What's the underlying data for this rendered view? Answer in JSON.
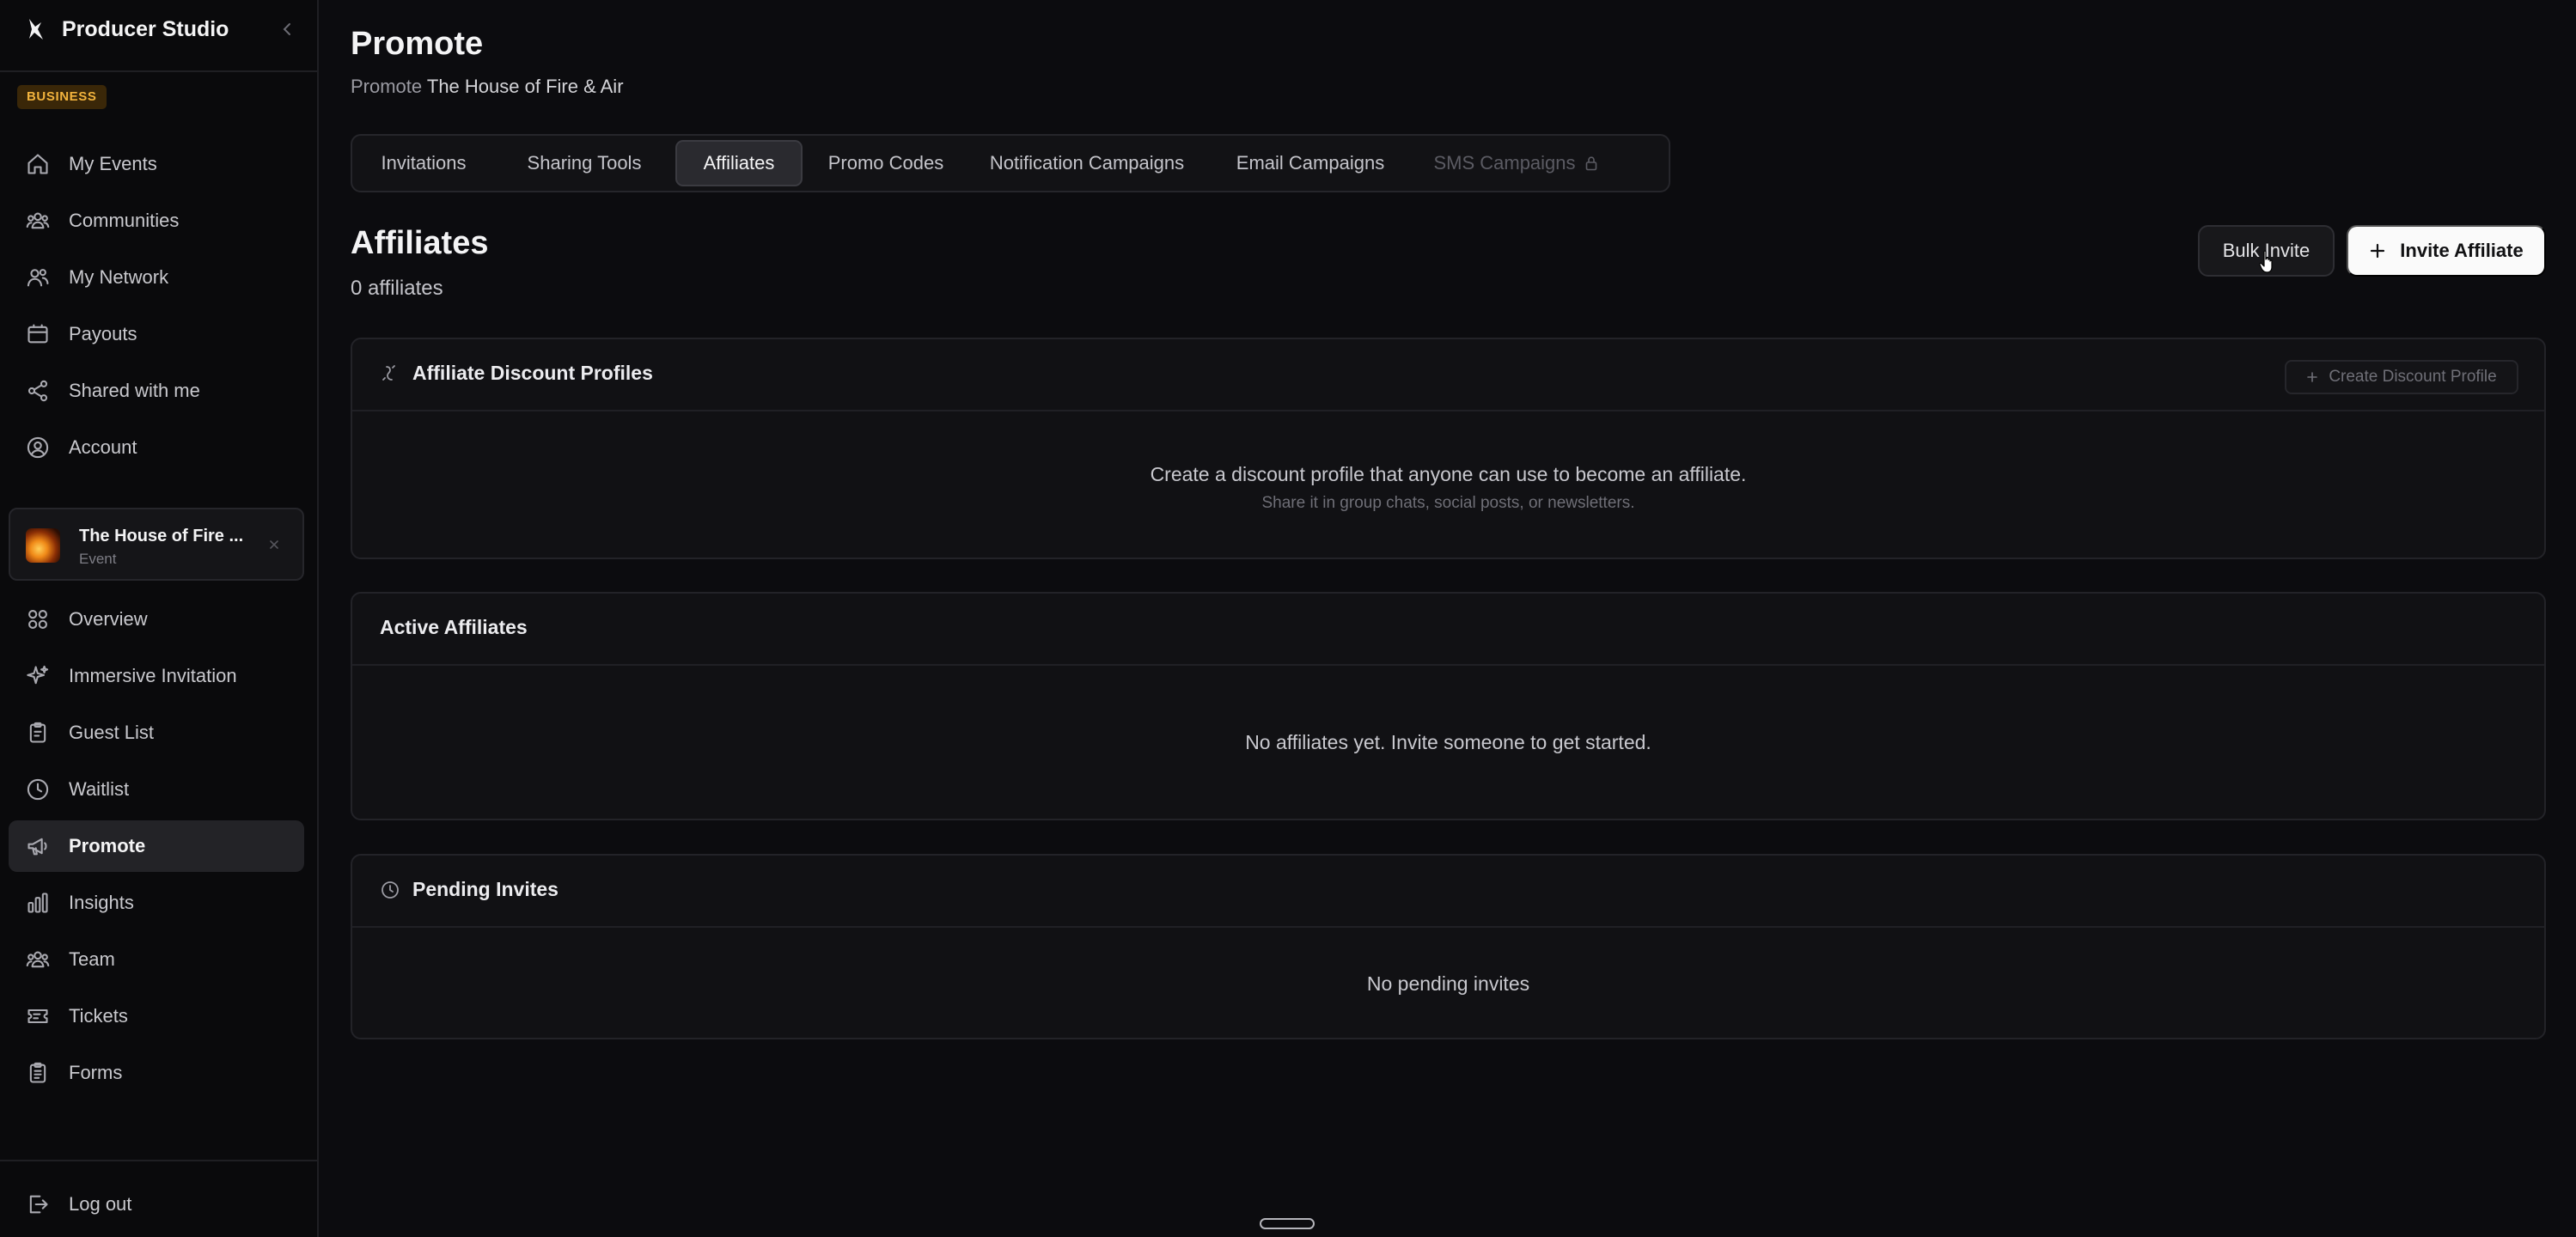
{
  "brand": {
    "name": "Producer Studio",
    "plan_badge": "BUSINESS"
  },
  "sidebar": {
    "items": [
      {
        "label": "My Events",
        "icon": "home-icon"
      },
      {
        "label": "Communities",
        "icon": "users-icon"
      },
      {
        "label": "My Network",
        "icon": "network-icon"
      },
      {
        "label": "Payouts",
        "icon": "payouts-icon"
      },
      {
        "label": "Shared with me",
        "icon": "share-icon"
      },
      {
        "label": "Account",
        "icon": "account-icon"
      }
    ],
    "event": {
      "title": "The House of Fire ...",
      "type": "Event"
    },
    "event_items": [
      {
        "label": "Overview",
        "icon": "grid-icon"
      },
      {
        "label": "Immersive Invitation",
        "icon": "sparkles-icon"
      },
      {
        "label": "Guest List",
        "icon": "clipboard-icon"
      },
      {
        "label": "Waitlist",
        "icon": "clock-icon"
      },
      {
        "label": "Promote",
        "icon": "megaphone-icon",
        "active": true
      },
      {
        "label": "Insights",
        "icon": "bar-chart-icon"
      },
      {
        "label": "Team",
        "icon": "team-icon"
      },
      {
        "label": "Tickets",
        "icon": "ticket-icon"
      },
      {
        "label": "Forms",
        "icon": "forms-icon"
      }
    ],
    "logout": {
      "label": "Log out",
      "icon": "logout-icon"
    }
  },
  "header": {
    "title": "Promote",
    "subtitle_prefix": "Promote",
    "subtitle_event": "The House of Fire & Air"
  },
  "tabs": [
    {
      "label": "Invitations"
    },
    {
      "label": "Sharing Tools"
    },
    {
      "label": "Affiliates",
      "active": true
    },
    {
      "label": "Promo Codes"
    },
    {
      "label": "Notification Campaigns"
    },
    {
      "label": "Email Campaigns"
    },
    {
      "label": "SMS Campaigns",
      "locked": true
    }
  ],
  "affiliates": {
    "title": "Affiliates",
    "count": "0 affiliates",
    "bulk_invite_label": "Bulk Invite",
    "invite_label": "Invite Affiliate"
  },
  "discount_profiles": {
    "title": "Affiliate Discount Profiles",
    "create_label": "Create Discount Profile",
    "empty_text": "Create a discount profile that anyone can use to become an affiliate.",
    "empty_sub": "Share it in group chats, social posts, or newsletters."
  },
  "active_affiliates": {
    "title": "Active Affiliates",
    "empty_text": "No affiliates yet. Invite someone to get started."
  },
  "pending_invites": {
    "title": "Pending Invites",
    "empty_text": "No pending invites"
  },
  "colors": {
    "accent_badge": "#f2b33d",
    "background": "#0c0c0f",
    "primary_button": "#fafafa"
  }
}
